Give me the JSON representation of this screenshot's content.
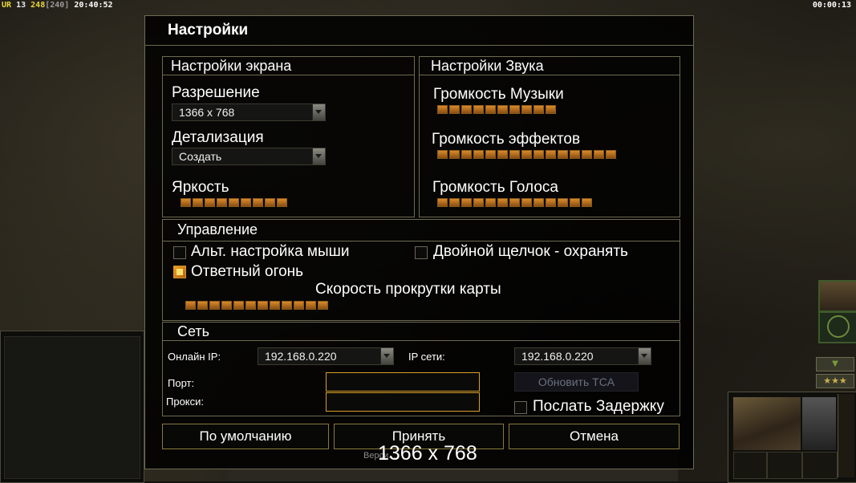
{
  "hud": {
    "ur": "UR",
    "num1": "13",
    "num2": "248",
    "num3": "[240]",
    "clock": "20:40:52",
    "timer": "00:00:13"
  },
  "dialog": {
    "title": "Настройки",
    "screen": {
      "title": "Настройки экрана",
      "resolution_label": "Разрешение",
      "resolution_value": "1366 x 768",
      "detail_label": "Детализация",
      "detail_value": "Создать",
      "brightness_label": "Яркость",
      "brightness_level": 9,
      "brightness_max": 9
    },
    "sound": {
      "title": "Настройки Звука",
      "music_label": "Громкость Музыки",
      "music_level": 10,
      "effects_label": "Громкость эффектов",
      "effects_level": 15,
      "voice_label": "Громкость Голоса",
      "voice_level": 13
    },
    "controls": {
      "title": "Управление",
      "alt_mouse_label": "Альт. настройка мыши",
      "alt_mouse_checked": false,
      "double_click_label": "Двойной щелчок - охранять",
      "double_click_checked": false,
      "retaliation_label": "Ответный огонь",
      "retaliation_checked": true,
      "scroll_label": "Скорость прокрутки карты",
      "scroll_level": 12
    },
    "network": {
      "title": "Сеть",
      "online_ip_label": "Онлайн IP:",
      "online_ip_value": "192.168.0.220",
      "lan_ip_label": "IP сети:",
      "lan_ip_value": "192.168.0.220",
      "port_label": "Порт:",
      "port_value": "",
      "proxy_label": "Прокси:",
      "proxy_value": "",
      "update_tca_label": "Обновить TCA",
      "send_delay_label": "Послать Задержку",
      "send_delay_checked": false
    },
    "buttons": {
      "defaults": "По умолчанию",
      "accept": "Принять",
      "cancel": "Отмена"
    },
    "version_text": "Верси...",
    "resolution_overlay": "1366 x 768"
  },
  "colors": {
    "panel_border": "#6e6b52",
    "slider_on": "#d88a2a",
    "input_border": "#d8a02a",
    "button_border": "#8a7a3a"
  }
}
